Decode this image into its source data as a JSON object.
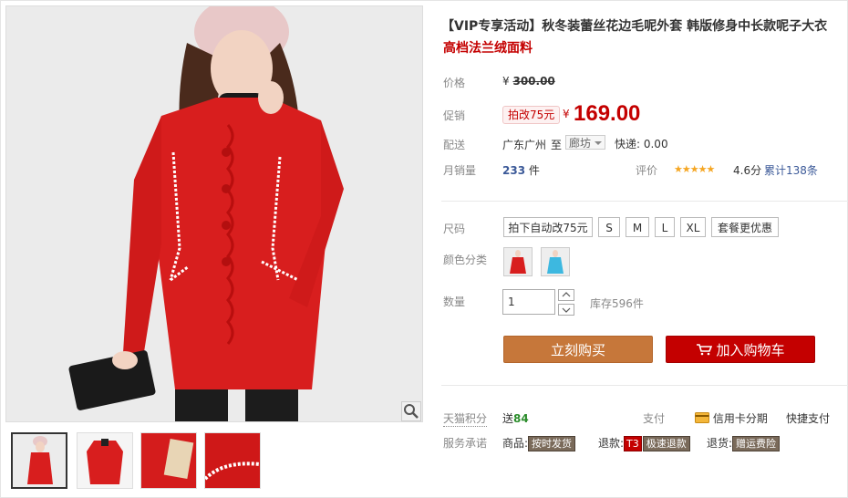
{
  "product": {
    "title": "【VIP专享活动】秋冬装蕾丝花边毛呢外套 韩版修身中长款呢子大衣",
    "subtitle": "高档法兰绒面料"
  },
  "price": {
    "label": "价格",
    "yen": "¥",
    "original": "300.00"
  },
  "promo": {
    "label": "促销",
    "tag": "拍改75元",
    "yen": "¥",
    "price": "169.00"
  },
  "shipping": {
    "label": "配送",
    "from": "广东广州",
    "to_word": "至",
    "destination": "廊坊",
    "express": "快递: 0.00"
  },
  "sales": {
    "label": "月销量",
    "count": "233",
    "unit": "件",
    "rating_label": "评价",
    "stars": "★★★★★",
    "rating_score": 4.6,
    "score": "4.6分",
    "reviews": "累计138条"
  },
  "size": {
    "label": "尺码",
    "options": [
      "拍下自动改75元",
      "S",
      "M",
      "L",
      "XL",
      "套餐更优惠"
    ]
  },
  "color": {
    "label": "颜色分类",
    "options": [
      "red-coat",
      "blue-coat"
    ]
  },
  "quantity": {
    "label": "数量",
    "value": "1",
    "stock": "库存596件"
  },
  "actions": {
    "buy_now": "立刻购买",
    "add_cart": "加入购物车"
  },
  "points": {
    "label": "天猫积分",
    "send": "送",
    "value": "84",
    "pay_label": "支付",
    "credit": "信用卡分期",
    "quick": "快捷支付"
  },
  "service": {
    "label": "服务承诺",
    "goods": "商品:",
    "goods_badge": "按时发货",
    "refund": "退款:",
    "refund_t3": "T3",
    "refund_badge": "极速退款",
    "return": "退货:",
    "return_badge": "赠运费险"
  },
  "colors": {
    "accent": "#c40000",
    "buy_now": "#c6773a",
    "star": "#f5a623"
  }
}
